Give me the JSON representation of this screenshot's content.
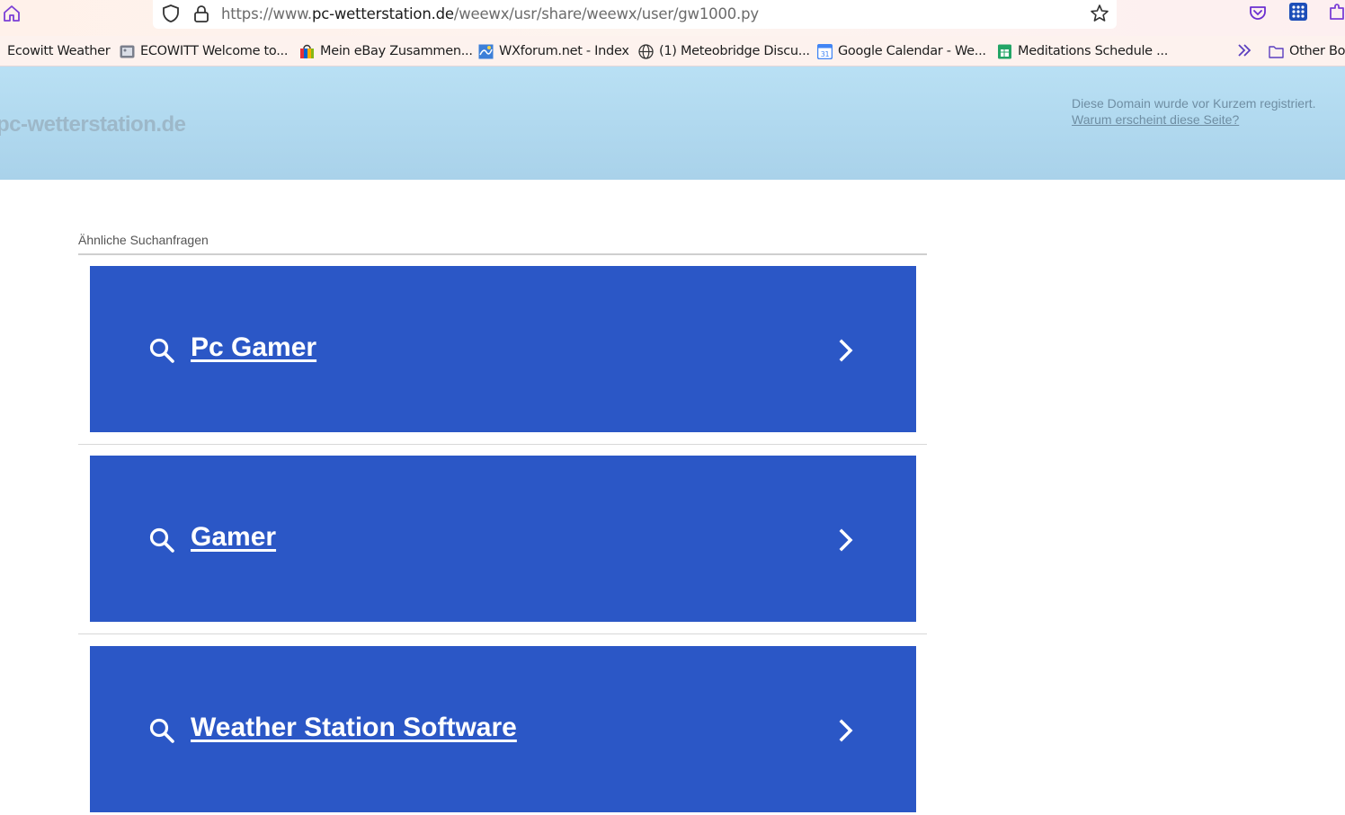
{
  "browser": {
    "url_prefix": "https://www.",
    "url_host": "pc-wetterstation.de",
    "url_path": "/weewx/usr/share/weewx/user/gw1000.py",
    "bookmarks": [
      {
        "label": "Ecowitt Weather",
        "icon": "ecowitt-icon"
      },
      {
        "label": "ECOWITT Welcome to...",
        "icon": "ecowitt-page-icon"
      },
      {
        "label": "Mein eBay Zusammen...",
        "icon": "ebay-bag-icon"
      },
      {
        "label": "WXforum.net - Index",
        "icon": "wxforum-icon"
      },
      {
        "label": "(1) Meteobridge Discu...",
        "icon": "globe-icon"
      },
      {
        "label": "Google Calendar - We...",
        "icon": "google-calendar-icon"
      },
      {
        "label": "Meditations Schedule ...",
        "icon": "google-sheets-icon"
      }
    ],
    "other_bookmarks": "Other Boo"
  },
  "page": {
    "site_name": "pc-wetterstation.de",
    "notice_line1": "Diese Domain wurde vor Kurzem registriert.",
    "notice_link": "Warum erscheint diese Seite?",
    "related_title": "Ähnliche Suchanfragen",
    "results": [
      {
        "label": "Pc Gamer"
      },
      {
        "label": "Gamer"
      },
      {
        "label": "Weather Station Software"
      }
    ]
  },
  "colors": {
    "card_bg": "#2b57c6",
    "banner_top": "#b9e0f4",
    "banner_bottom": "#a9d2ea"
  }
}
